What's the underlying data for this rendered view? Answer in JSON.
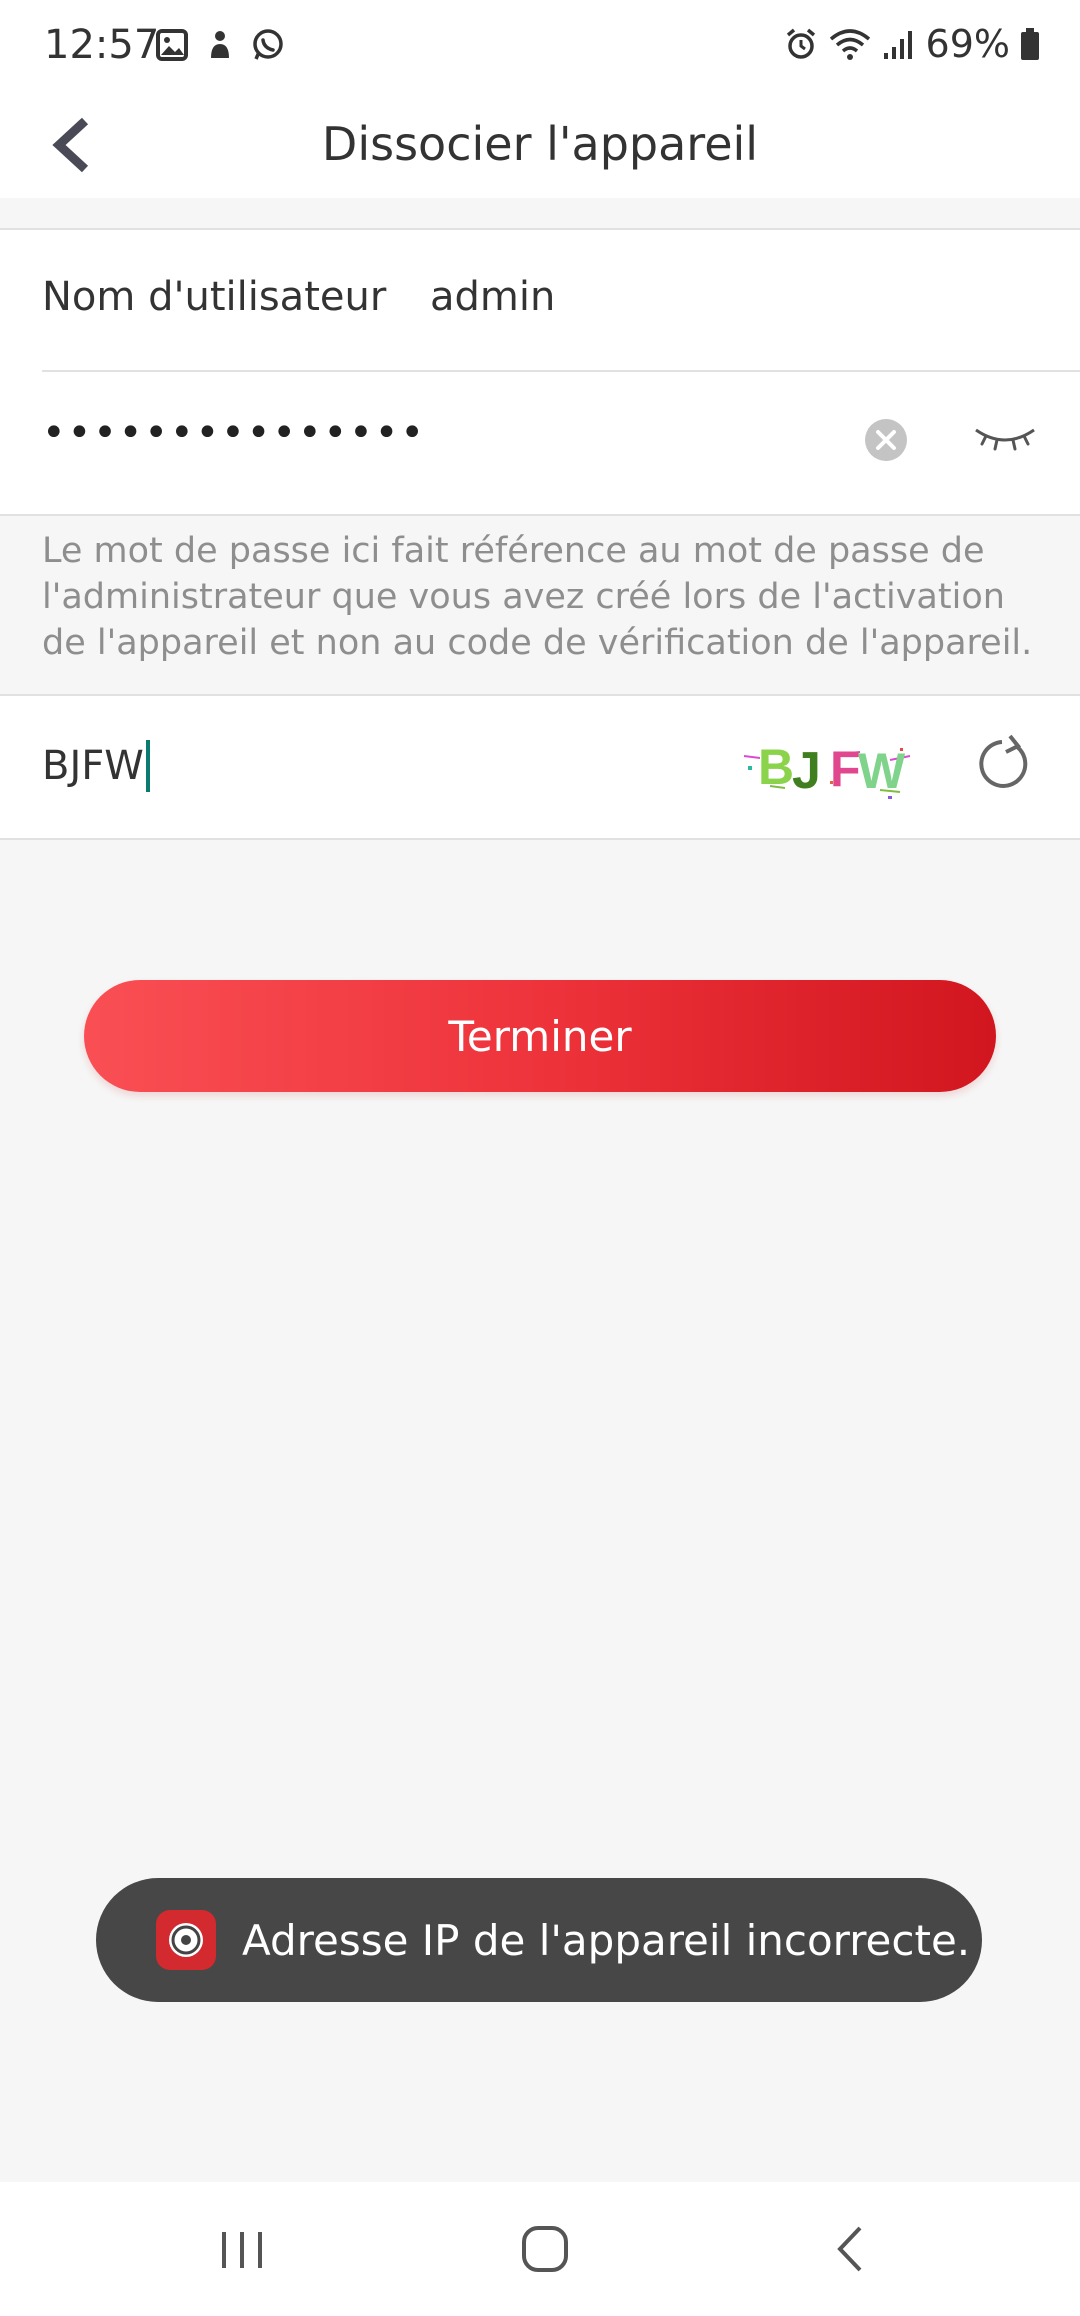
{
  "status_bar": {
    "time": "12:57",
    "battery": "69%"
  },
  "header": {
    "title": "Dissocier l'appareil"
  },
  "form": {
    "username_label": "Nom d'utilisateur",
    "username_value": "admin",
    "password_masked": "•••••••••••••••",
    "hint": "Le mot de passe ici fait référence au mot de passe de l'administrateur que vous avez créé lors de l'activation de l'appareil et non au code de vérification de l'appareil.",
    "captcha_value": "BJFW",
    "captcha_image_text": "BJFW"
  },
  "actions": {
    "finish_label": "Terminer"
  },
  "toast": {
    "message": "Adresse IP de l'appareil incorrecte."
  },
  "colors": {
    "accent_red": "#ee333b",
    "caret_teal": "#0a7b6e",
    "toast_bg": "#474747"
  }
}
